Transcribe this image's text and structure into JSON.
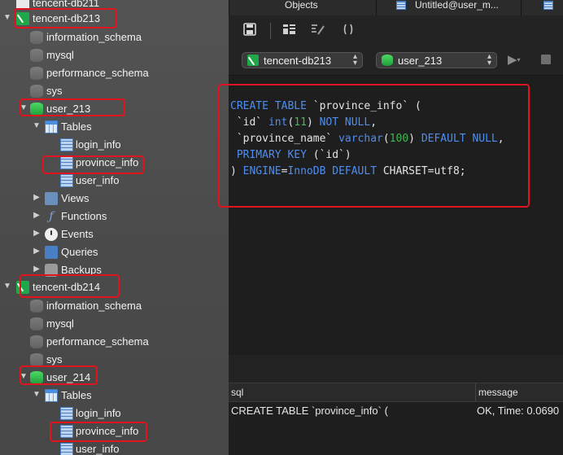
{
  "sidebar": {
    "conn_prev": "tencent-db211",
    "conn1": {
      "label": "tencent-db213",
      "databases": [
        "information_schema",
        "mysql",
        "performance_schema",
        "sys"
      ],
      "db_user": "user_213",
      "tables_label": "Tables",
      "tables": [
        "login_info",
        "province_info",
        "user_info"
      ],
      "groups": [
        "Views",
        "Functions",
        "Events",
        "Queries",
        "Backups"
      ]
    },
    "conn2": {
      "label": "tencent-db214",
      "databases": [
        "information_schema",
        "mysql",
        "performance_schema",
        "sys"
      ],
      "db_user": "user_214",
      "tables_label": "Tables",
      "tables": [
        "login_info",
        "province_info",
        "user_info"
      ]
    }
  },
  "tabs": {
    "objects": "Objects",
    "untitled": "Untitled@user_m..."
  },
  "toolbar": {
    "connection_select": "tencent-db213",
    "database_select": "user_213"
  },
  "editor": {
    "lines": [
      [
        {
          "t": "CREATE TABLE",
          "c": "kw"
        },
        {
          "t": " `province_info` (",
          "c": ""
        }
      ],
      [
        {
          "t": " `id` ",
          "c": ""
        },
        {
          "t": "int",
          "c": "kw"
        },
        {
          "t": "(",
          "c": ""
        },
        {
          "t": "11",
          "c": "num"
        },
        {
          "t": ") ",
          "c": ""
        },
        {
          "t": "NOT NULL",
          "c": "kw"
        },
        {
          "t": ",",
          "c": ""
        }
      ],
      [
        {
          "t": " `province_name` ",
          "c": ""
        },
        {
          "t": "varchar",
          "c": "kw"
        },
        {
          "t": "(",
          "c": ""
        },
        {
          "t": "100",
          "c": "num"
        },
        {
          "t": ") ",
          "c": ""
        },
        {
          "t": "DEFAULT NULL",
          "c": "kw"
        },
        {
          "t": ",",
          "c": ""
        }
      ],
      [
        {
          "t": " PRIMARY KEY",
          "c": "kw"
        },
        {
          "t": " (`id`)",
          "c": ""
        }
      ],
      [
        {
          "t": ") ",
          "c": ""
        },
        {
          "t": "ENGINE",
          "c": "kw"
        },
        {
          "t": "=",
          "c": ""
        },
        {
          "t": "InnoDB DEFAULT",
          "c": "kw"
        },
        {
          "t": " CHARSET=utf8;",
          "c": ""
        }
      ]
    ]
  },
  "results": {
    "col_sql": "sql",
    "col_message": "message",
    "row_sql": "CREATE TABLE `province_info` (",
    "row_message": "OK, Time: 0.0690"
  },
  "colors": {
    "highlight": "#e0141d",
    "keyword": "#4e8ef0",
    "number": "#3fb950"
  }
}
